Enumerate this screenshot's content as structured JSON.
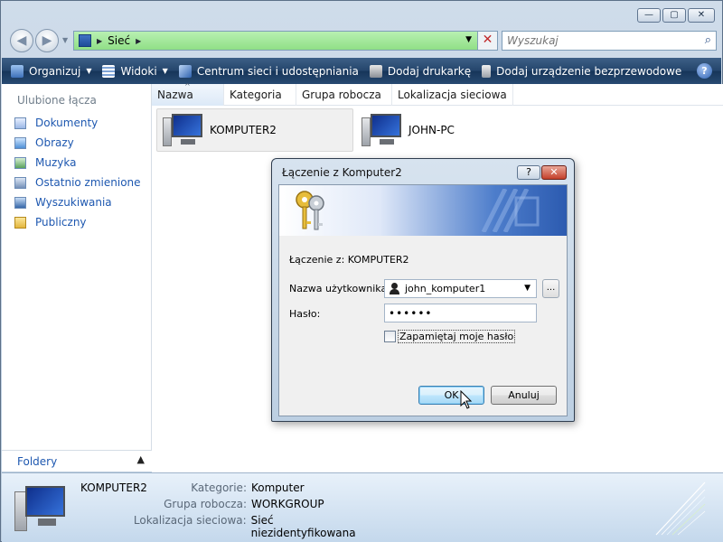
{
  "window": {
    "caption_buttons": {
      "minimize": "—",
      "maximize": "▢",
      "close": "✕"
    }
  },
  "nav": {
    "back_glyph": "◀",
    "forward_glyph": "▶",
    "address_path": "Sieć",
    "search_placeholder": "Wyszukaj"
  },
  "toolbar": {
    "items": [
      {
        "label": "Organizuj",
        "icon": "organize-icon",
        "has_menu": true
      },
      {
        "label": "Widoki",
        "icon": "views-icon",
        "has_menu": true
      },
      {
        "label": "Centrum sieci i udostępniania",
        "icon": "network-center-icon",
        "has_menu": false
      },
      {
        "label": "Dodaj drukarkę",
        "icon": "printer-icon",
        "has_menu": false
      },
      {
        "label": "Dodaj urządzenie bezprzewodowe",
        "icon": "wireless-device-icon",
        "has_menu": false
      }
    ],
    "help_label": "?"
  },
  "sidebar": {
    "title": "Ulubione łącza",
    "items": [
      {
        "label": "Dokumenty",
        "icon": "documents-icon"
      },
      {
        "label": "Obrazy",
        "icon": "pictures-icon"
      },
      {
        "label": "Muzyka",
        "icon": "music-icon"
      },
      {
        "label": "Ostatnio zmienione",
        "icon": "recent-icon"
      },
      {
        "label": "Wyszukiwania",
        "icon": "searches-icon"
      },
      {
        "label": "Publiczny",
        "icon": "public-folder-icon"
      }
    ],
    "folders_label": "Foldery"
  },
  "main": {
    "columns": [
      "Nazwa",
      "Kategoria",
      "Grupa robocza",
      "Lokalizacja sieciowa"
    ],
    "items": [
      {
        "name": "KOMPUTER2",
        "selected": true
      },
      {
        "name": "JOHN-PC",
        "selected": false
      }
    ]
  },
  "details": {
    "name": "KOMPUTER2",
    "rows": [
      {
        "label": "Kategorie:",
        "value": "Komputer"
      },
      {
        "label": "Grupa robocza:",
        "value": "WORKGROUP"
      },
      {
        "label": "Lokalizacja sieciowa:",
        "value": "Sieć niezidentyfikowana"
      }
    ]
  },
  "dialog": {
    "title": "Łączenie z Komputer2",
    "help_glyph": "?",
    "close_glyph": "✕",
    "connect_to": "Łączenie z: KOMPUTER2",
    "username_label": "Nazwa użytkownika:",
    "username_value": "john_komputer1",
    "browse_label": "...",
    "password_label": "Hasło:",
    "password_value": "123456",
    "remember_label": "Zapamiętaj moje hasło",
    "remember_checked": false,
    "ok_label": "OK",
    "cancel_label": "Anuluj"
  }
}
